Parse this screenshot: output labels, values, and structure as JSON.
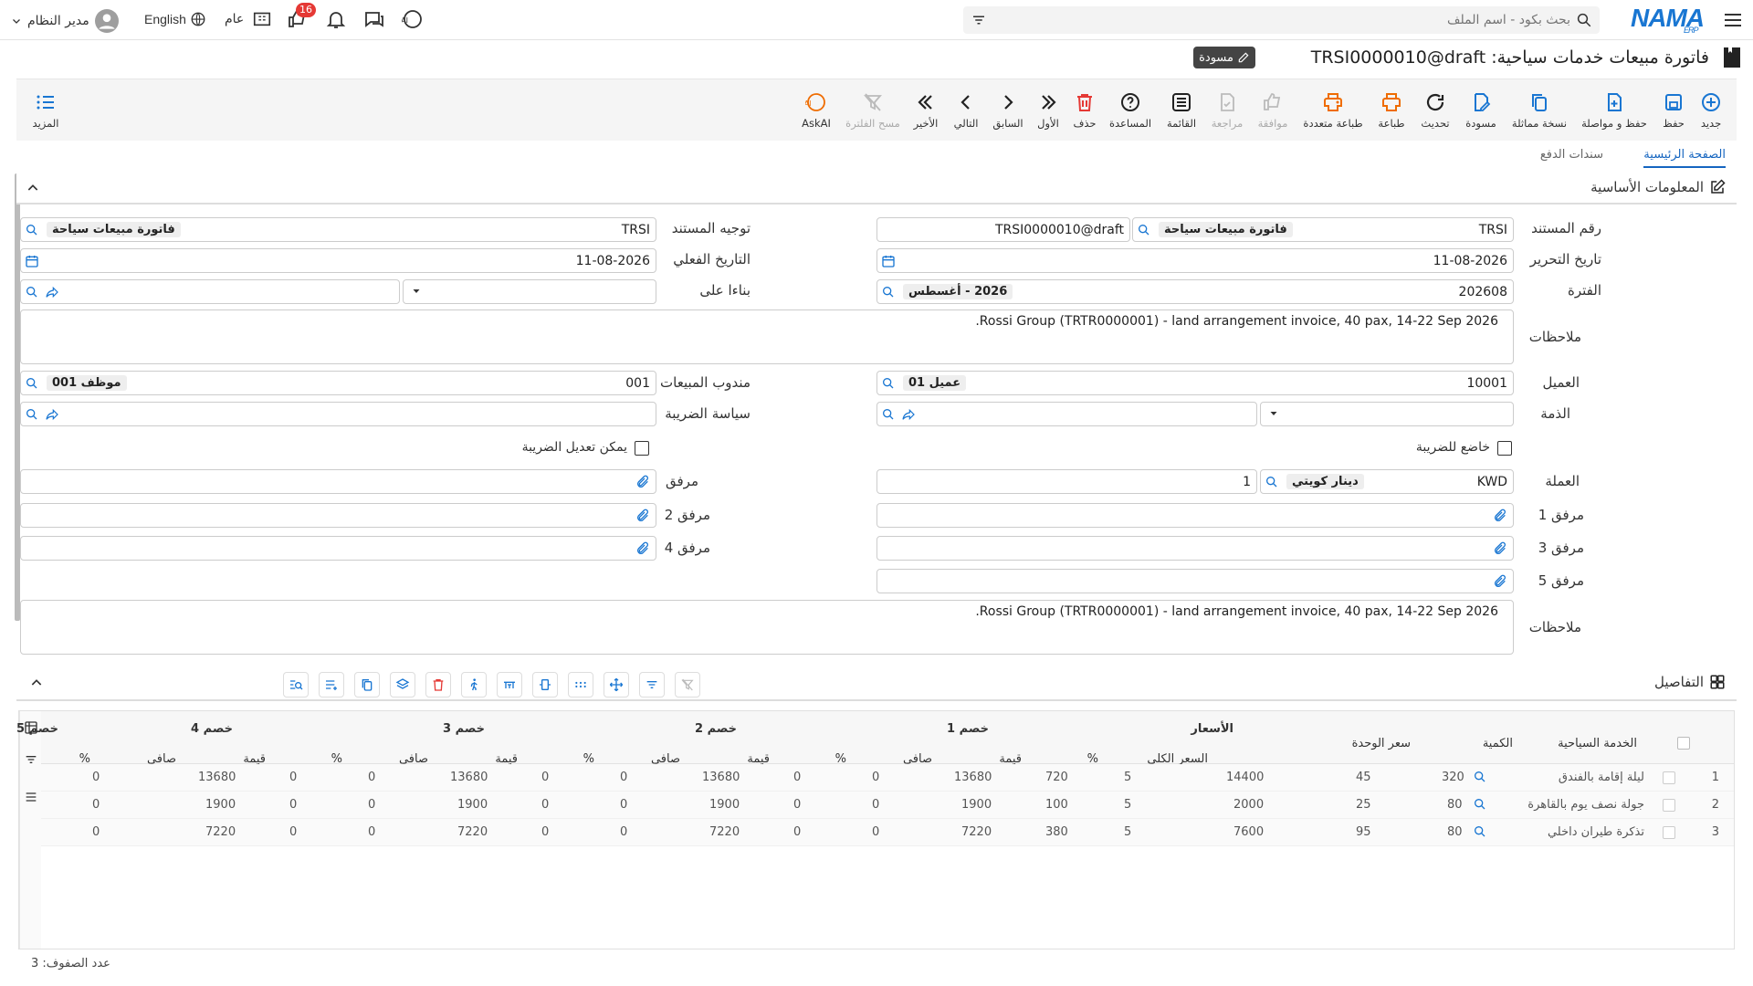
{
  "topbar": {
    "logo": "NAMA",
    "logo_sub": "ERP",
    "search_placeholder": "بحث بكود - اسم الملف",
    "user_name": "مدير النظام",
    "language": "English",
    "scope": "عام",
    "notif_count": "16"
  },
  "page": {
    "title": "فاتورة مبيعات خدمات سياحية: TRSI0000010@draft",
    "status": "مسودة"
  },
  "toolbar": [
    {
      "id": "new",
      "label": "جديد"
    },
    {
      "id": "save",
      "label": "حفظ"
    },
    {
      "id": "save_continue",
      "label": "حفظ و مواصلة"
    },
    {
      "id": "duplicate",
      "label": "نسخة مماثلة"
    },
    {
      "id": "draft",
      "label": "مسودة"
    },
    {
      "id": "refresh",
      "label": "تحديث"
    },
    {
      "id": "print",
      "label": "طباعة"
    },
    {
      "id": "multi_print",
      "label": "طباعة متعددة"
    },
    {
      "id": "approve",
      "label": "موافقة"
    },
    {
      "id": "review",
      "label": "مراجعة"
    },
    {
      "id": "list",
      "label": "القائمة"
    },
    {
      "id": "help",
      "label": "المساعدة"
    },
    {
      "id": "delete",
      "label": "حذف"
    },
    {
      "id": "first",
      "label": "الأول"
    },
    {
      "id": "prev",
      "label": "السابق"
    },
    {
      "id": "next",
      "label": "التالي"
    },
    {
      "id": "last",
      "label": "الأخير"
    },
    {
      "id": "clear_filter",
      "label": "مسح الفلترة"
    },
    {
      "id": "askai",
      "label": "AskAI"
    },
    {
      "id": "more",
      "label": "المزيد"
    }
  ],
  "tabs": {
    "main": "الصفحة الرئيسية",
    "payments": "سندات الدفع"
  },
  "basic": {
    "section_title": "المعلومات الأساسية",
    "doc_no_label": "رقم المستند",
    "doc_no_code": "TRSI",
    "doc_no_type": "فاتورة مبيعات سياحة",
    "doc_no_value": "TRSI0000010@draft",
    "doc_dir_label": "توجيه المستند",
    "doc_dir_code": "TRSI",
    "doc_dir_type": "فاتورة مبيعات سياحة",
    "date_label": "تاريخ التحرير",
    "date_value": "11-08-2026",
    "actual_date_label": "التاريخ الفعلي",
    "actual_date_value": "11-08-2026",
    "period_label": "الفترة",
    "period_code": "202608",
    "period_name": "2026 - أغسطس",
    "based_on_label": "بناءا على",
    "notes_label": "ملاحظات",
    "notes_value": "Rossi Group (TRTR0000001) - land arrangement invoice, 40 pax, 14-22 Sep 2026.",
    "customer_label": "العميل",
    "customer_code": "10001",
    "customer_name": "عميل 01",
    "sales_rep_label": "مندوب المبيعات",
    "sales_rep_code": "001",
    "sales_rep_name": "موظف 001",
    "liability_label": "الذمة",
    "tax_policy_label": "سياسة الضريبة",
    "taxable_label": "خاضع للضريبة",
    "tax_editable_label": "يمكن تعديل الضريبة",
    "currency_label": "العملة",
    "currency_code": "KWD",
    "currency_name": "دينار كويتي",
    "rate_value": "1",
    "attach_label": "مرفق",
    "attach1_label": "مرفق 1",
    "attach2_label": "مرفق 2",
    "attach3_label": "مرفق 3",
    "attach4_label": "مرفق 4",
    "attach5_label": "مرفق 5",
    "notes2_label": "ملاحظات",
    "notes2_value": "Rossi Group (TRTR0000001) - land arrangement invoice, 40 pax, 14-22 Sep 2026."
  },
  "details": {
    "section_title": "التفاصيل",
    "group_headers": {
      "prices": "الأسعار",
      "d1": "خصم 1",
      "d2": "خصم 2",
      "d3": "خصم 3",
      "d4": "خصم 4",
      "d5": "خصم 5"
    },
    "columns": {
      "service": "الخدمة السياحية",
      "qty": "الكمية",
      "unit_price": "سعر الوحدة",
      "total": "السعر الكلي",
      "pct": "%",
      "value": "قيمة",
      "net": "صافي"
    },
    "rows": [
      {
        "n": "1",
        "service": "ليلة إقامة بالفندق",
        "qty": "320",
        "unit": "45",
        "total": "14400",
        "d1p": "5",
        "d1v": "720",
        "d1n": "13680",
        "d2p": "0",
        "d2v": "0",
        "d2n": "13680",
        "d3p": "0",
        "d3v": "0",
        "d3n": "13680",
        "d4p": "0",
        "d4v": "0",
        "d4n": "13680",
        "d5p": "0"
      },
      {
        "n": "2",
        "service": "جولة نصف يوم بالقاهرة",
        "qty": "80",
        "unit": "25",
        "total": "2000",
        "d1p": "5",
        "d1v": "100",
        "d1n": "1900",
        "d2p": "0",
        "d2v": "0",
        "d2n": "1900",
        "d3p": "0",
        "d3v": "0",
        "d3n": "1900",
        "d4p": "0",
        "d4v": "0",
        "d4n": "1900",
        "d5p": "0"
      },
      {
        "n": "3",
        "service": "تذكرة طيران داخلي",
        "qty": "80",
        "unit": "95",
        "total": "7600",
        "d1p": "5",
        "d1v": "380",
        "d1n": "7220",
        "d2p": "0",
        "d2v": "0",
        "d2n": "7220",
        "d3p": "0",
        "d3v": "0",
        "d3n": "7220",
        "d4p": "0",
        "d4v": "0",
        "d4n": "7220",
        "d5p": "0"
      }
    ],
    "row_count_label": "عدد الصفوف: 3"
  },
  "colors": {
    "accent": "#1976d2",
    "danger": "#e53935",
    "orange": "#ef6c00"
  }
}
